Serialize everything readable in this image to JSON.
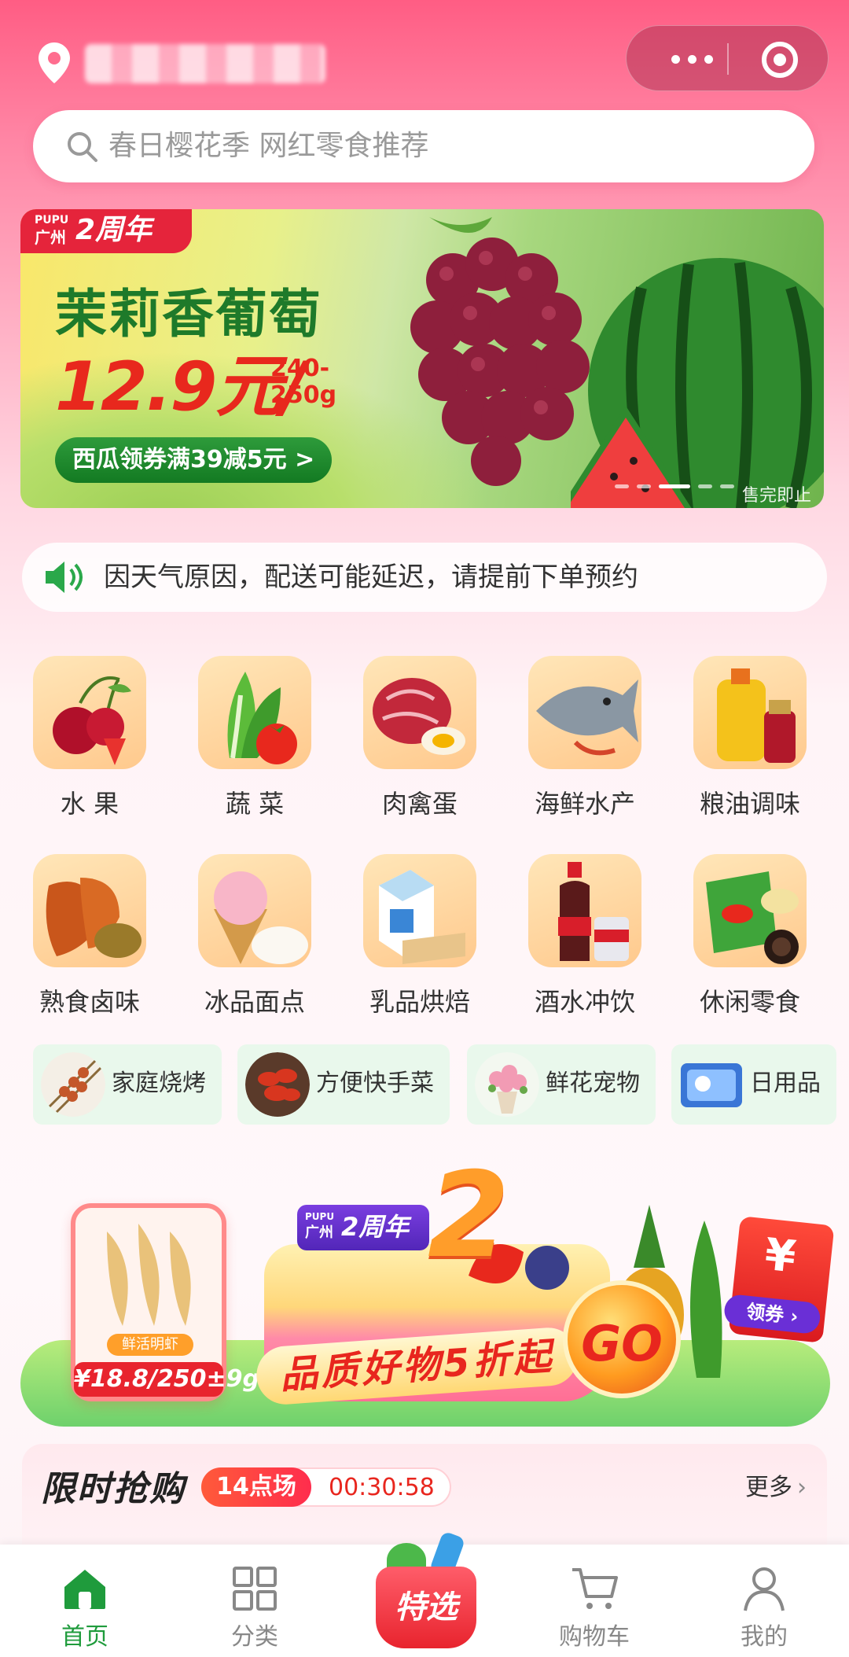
{
  "header": {
    "search_placeholder": "春日樱花季 网红零食推荐"
  },
  "hero_banner": {
    "tag_pupu": "PUPU",
    "tag_city": "广州",
    "tag_anniversary": "2周年",
    "title": "茉莉香葡萄",
    "price": "12.9元/",
    "weight": "240-250g",
    "coupon": "西瓜领券满39减5元 >",
    "sold_out_note": "售完即止"
  },
  "notice": {
    "text": "因天气原因，配送可能延迟，请提前下单预约"
  },
  "categories": [
    {
      "label": "水 果",
      "icon": "cherry-icon"
    },
    {
      "label": "蔬 菜",
      "icon": "vegetable-icon"
    },
    {
      "label": "肉禽蛋",
      "icon": "meat-icon"
    },
    {
      "label": "海鲜水产",
      "icon": "fish-icon"
    },
    {
      "label": "粮油调味",
      "icon": "oil-icon"
    },
    {
      "label": "熟食卤味",
      "icon": "chicken-wing-icon"
    },
    {
      "label": "冰品面点",
      "icon": "ice-cream-icon"
    },
    {
      "label": "乳品烘焙",
      "icon": "milk-icon"
    },
    {
      "label": "酒水冲饮",
      "icon": "cola-icon"
    },
    {
      "label": "休闲零食",
      "icon": "snack-icon"
    }
  ],
  "sub_categories": [
    {
      "label": "家庭烧烤",
      "icon": "bbq-skewer-icon"
    },
    {
      "label": "方便快手菜",
      "icon": "crayfish-icon"
    },
    {
      "label": "鲜花宠物",
      "icon": "flower-icon"
    },
    {
      "label": "日用品",
      "icon": "tissue-icon"
    }
  ],
  "promo_banner": {
    "shrimp_name": "鲜活明虾",
    "shrimp_price": "¥18.8/250±9g",
    "anniv_pupu": "PUPU",
    "anniv_city": "广州",
    "anniv_text": "2周年",
    "big_number": "2",
    "slogan": "品质好物5折起",
    "go": "GO",
    "coupon_symbol": "¥",
    "coupon_label": "领券 ›"
  },
  "flash_sale": {
    "title": "限时抢购",
    "session": "14点场",
    "countdown": "00:30:58",
    "more": "更多"
  },
  "tabbar": {
    "home": "首页",
    "category": "分类",
    "special": "特选",
    "cart": "购物车",
    "mine": "我的"
  },
  "colors": {
    "brand_green": "#1f9b3c",
    "header_pink": "#ff5d84",
    "price_red": "#e8281d"
  }
}
